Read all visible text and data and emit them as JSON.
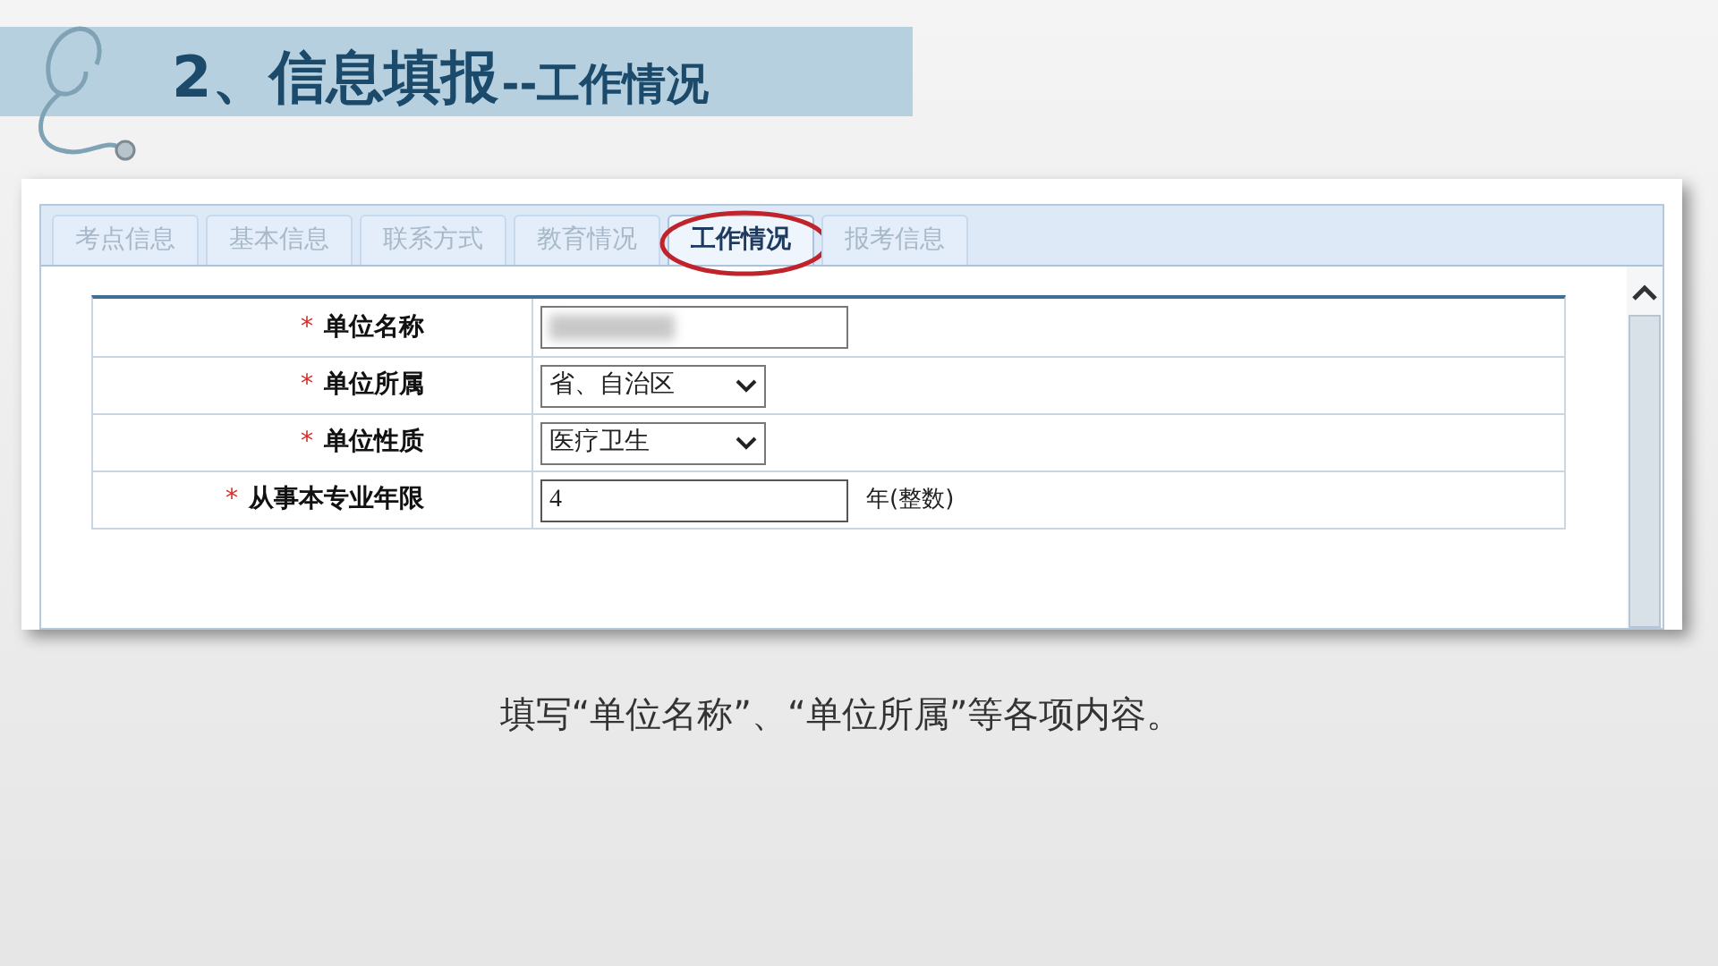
{
  "slide_title": {
    "main": "2、信息填报",
    "sub": "--工作情况"
  },
  "tabs": [
    {
      "label": "考点信息",
      "selected": false,
      "circled": false
    },
    {
      "label": "基本信息",
      "selected": false,
      "circled": false
    },
    {
      "label": "联系方式",
      "selected": false,
      "circled": false
    },
    {
      "label": "教育情况",
      "selected": false,
      "circled": false
    },
    {
      "label": "工作情况",
      "selected": true,
      "circled": true
    },
    {
      "label": "报考信息",
      "selected": false,
      "circled": false
    }
  ],
  "form_rows": [
    {
      "label": "单位名称",
      "required_mark": "*",
      "kind": "blurred"
    },
    {
      "label": "单位所属",
      "required_mark": "*",
      "kind": "select",
      "value": "省、自治区"
    },
    {
      "label": "单位性质",
      "required_mark": "*",
      "kind": "select",
      "value": "医疗卫生"
    },
    {
      "label": "从事本专业年限",
      "required_mark": "*",
      "kind": "text",
      "value": "4",
      "suffix": "年(整数)"
    }
  ],
  "caption": "填写“单位名称”、“单位所属”等各项内容。"
}
